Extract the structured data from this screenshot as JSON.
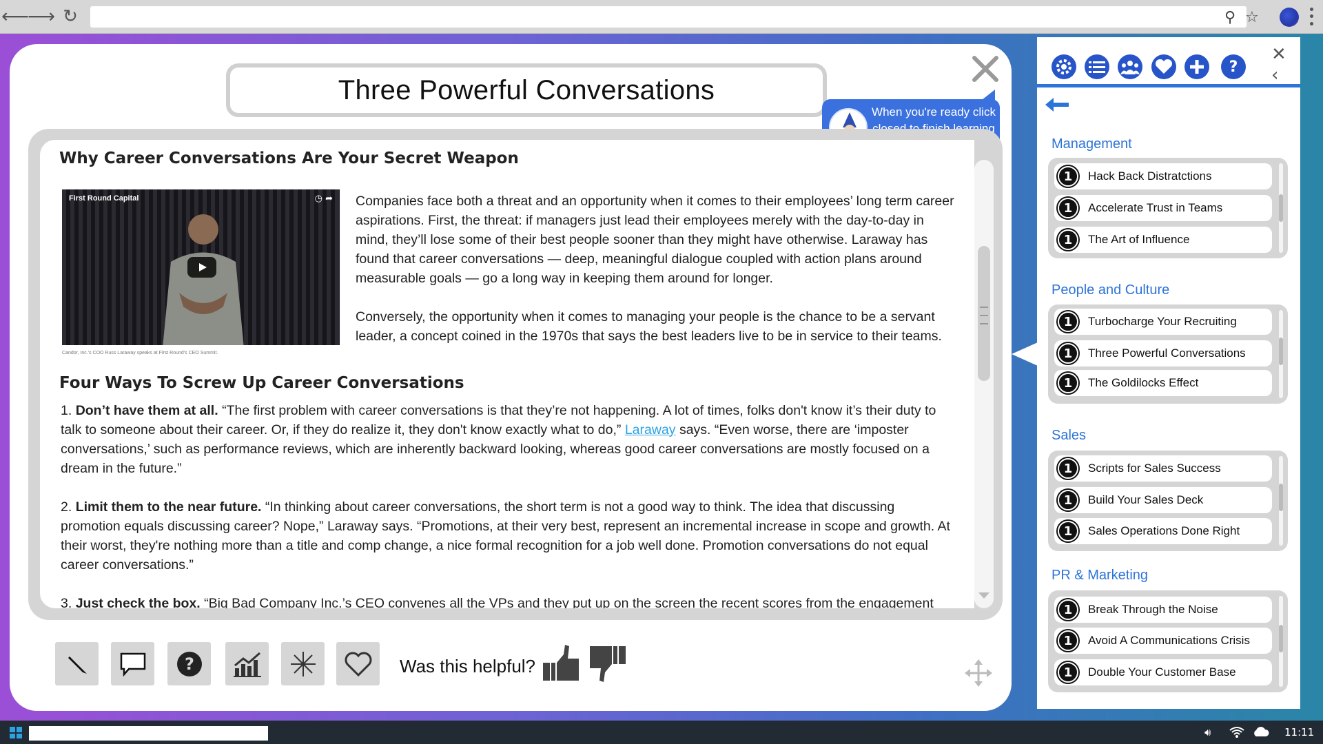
{
  "browser": {
    "back_icon": "back-arrow-icon",
    "forward_icon": "forward-arrow-icon",
    "reload_icon": "reload-icon",
    "address": "",
    "search_icon": "search-icon",
    "bookmark_icon": "star-icon"
  },
  "modal": {
    "title": "Three Powerful Conversations",
    "tooltip": "When you're ready click closed to finish learning & exploring."
  },
  "article": {
    "heading1": "Why Career Conversations Are Your Secret Weapon",
    "video_caption": "First Round Capital",
    "video_credit": "Candor, Inc.'s COO Russ Laraway speaks at First Round's CEO Summit.",
    "para1": "Companies face both a threat and an opportunity when it comes to their employees’ long term career aspirations. First, the threat: if managers just lead their employees merely with the day-to-day in mind, they’ll lose some of their best people sooner than they might have otherwise. Laraway has found that career conversations — deep, meaningful dialogue coupled with action plans around measurable goals — go a long way in keeping them around for longer.",
    "para2": "Conversely, the opportunity when it comes to managing your people is the chance to be a servant leader, a concept coined in the 1970s that says the best leaders live to be in service to their teams.",
    "heading2": "Four Ways To Screw Up Career Conversations",
    "item1_num": "1.",
    "item1_bold": "Don’t have them at all.",
    "item1_text_a": " “The first problem with career conversations is that they’re not happening. A lot of times, folks don't know it’s their duty to talk to someone about their career. Or, if they do realize it, they don't know exactly what to do,” ",
    "item1_link": "Laraway",
    "item1_text_b": " says. “Even worse, there are ‘imposter conversations,’ such as performance reviews, which are inherently backward looking, whereas good career conversations are mostly focused on a dream in the future.”",
    "item2_num": "2.",
    "item2_bold": "Limit them to the near future.",
    "item2_text": " “In thinking about career conversations, the short term is not a good way to think. The idea that discussing promotion equals discussing career? Nope,” Laraway says. “Promotions, at their very best, represent an incremental increase in scope and growth. At their worst, they're nothing more than a title and comp change, a nice formal recognition for a job well done. Promotion conversations do not equal career conversations.”",
    "item3_num": "3.",
    "item3_bold": "Just check the box.",
    "item3_text": " “Big Bad Company Inc.’s CEO convenes all the VPs and they put up on the screen the recent scores from the engagement"
  },
  "toolbar": {
    "tools": [
      "pencil-icon",
      "comment-icon",
      "help-icon",
      "chart-icon",
      "sparkle-icon",
      "heart-icon"
    ],
    "helpful_label": "Was this helpful?"
  },
  "sidebar": {
    "icons": [
      "gear-icon",
      "list-icon",
      "people-icon",
      "heart-icon",
      "plus-icon",
      "help-icon"
    ],
    "sections": [
      {
        "title": "Management",
        "items": [
          "Hack Back Distratctions",
          "Accelerate Trust in Teams",
          "The Art of Influence"
        ]
      },
      {
        "title": "People and Culture",
        "items": [
          "Turbocharge Your Recruiting",
          "Three Powerful Conversations",
          "The Goldilocks Effect"
        ]
      },
      {
        "title": "Sales",
        "items": [
          "Scripts for Sales Success",
          "Build Your Sales Deck",
          "Sales Operations Done Right"
        ]
      },
      {
        "title": "PR & Marketing",
        "items": [
          "Break Through the Noise",
          "Avoid A Communications Crisis",
          "Double Your Customer Base"
        ]
      }
    ],
    "badge": "1"
  },
  "taskbar": {
    "time": "11:11"
  },
  "colors": {
    "accent": "#2d74d8",
    "tooltip": "#3a71df",
    "link": "#2aa3e5"
  }
}
